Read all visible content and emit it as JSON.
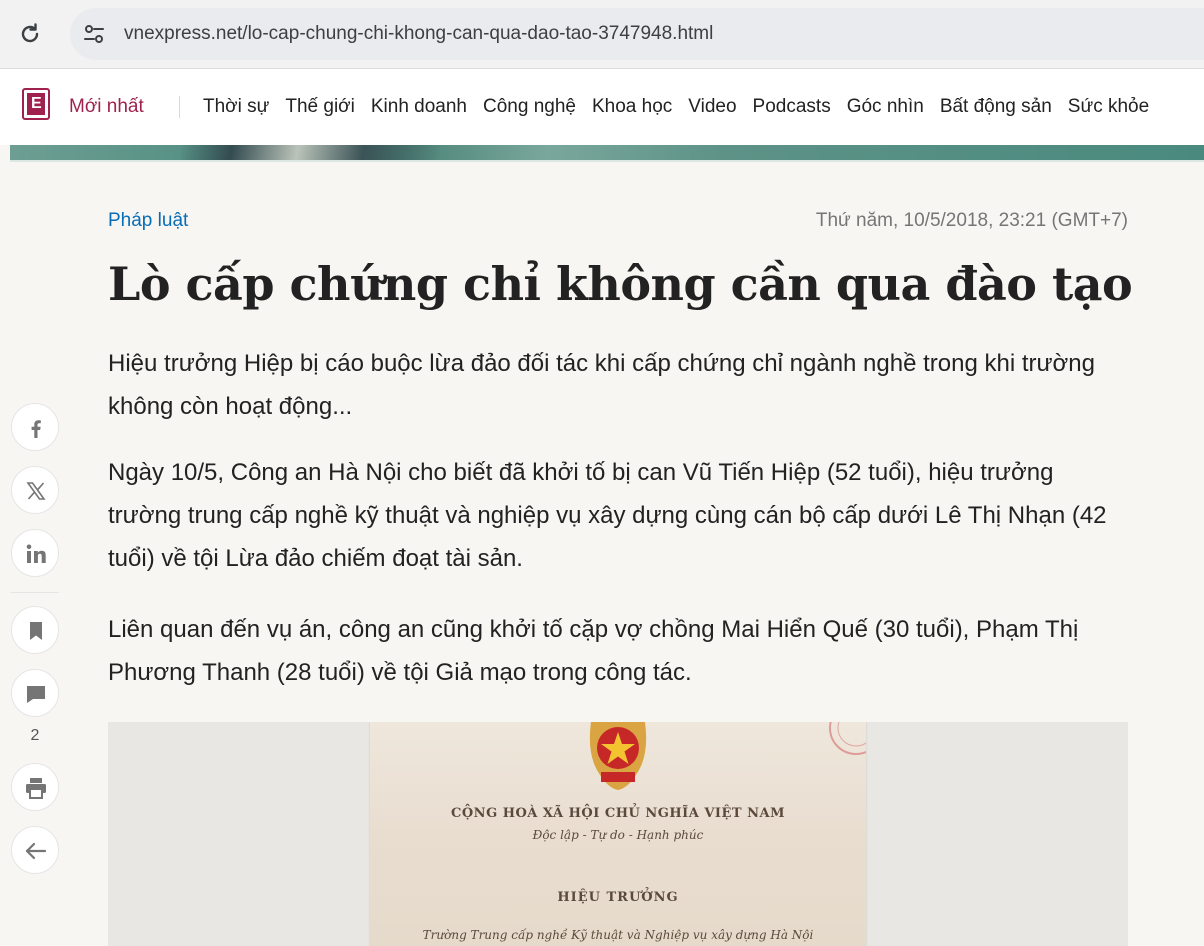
{
  "browser": {
    "url": "vnexpress.net/lo-cap-chung-chi-khong-can-qua-dao-tao-3747948.html"
  },
  "nav": {
    "latest": "Mới nhất",
    "items": [
      "Thời sự",
      "Thế giới",
      "Kinh doanh",
      "Công nghệ",
      "Khoa học",
      "Video",
      "Podcasts",
      "Góc nhìn",
      "Bất động sản",
      "Sức khỏe"
    ]
  },
  "article": {
    "category": "Pháp luật",
    "datetime": "Thứ năm, 10/5/2018, 23:21 (GMT+7)",
    "title": "Lò cấp chứng chỉ không cần qua đào tạo",
    "lead": "Hiệu trưởng Hiệp bị cáo buộc lừa đảo đối tác khi cấp chứng chỉ ngành nghề trong khi trường không còn hoạt động...",
    "paragraphs": [
      "Ngày 10/5, Công an Hà Nội cho biết đã khởi tố bị can Vũ Tiến Hiệp (52 tuổi), hiệu trưởng trường trung cấp nghề kỹ thuật và nghiệp vụ xây dựng cùng cán bộ cấp dưới Lê Thị Nhạn (42 tuổi) về tội Lừa đảo chiếm đoạt tài sản.",
      "Liên quan đến vụ án, công an cũng khởi tố cặp vợ chồng Mai Hiển Quế (30 tuổi), Phạm Thị Phương Thanh (28 tuổi) về tội Giả mạo trong công tác."
    ]
  },
  "certificate": {
    "country": "CỘNG HOÀ XÃ HỘI CHỦ NGHĨA VIỆT NAM",
    "motto": "Độc lập - Tự do - Hạnh phúc",
    "role": "HIỆU TRƯỞNG",
    "school": "Trường Trung cấp nghề Kỹ thuật và Nghiệp vụ xây dựng Hà Nội"
  },
  "share": {
    "comment_count": "2"
  },
  "icons": {
    "facebook": "facebook-icon",
    "x": "x-icon",
    "linkedin": "linkedin-icon",
    "save": "bookmark-icon",
    "comment": "comment-icon",
    "print": "print-icon",
    "back": "arrow-left-icon"
  },
  "colors": {
    "brand": "#9f224e",
    "category": "#076db6",
    "page_bg": "#f8f6f3"
  }
}
